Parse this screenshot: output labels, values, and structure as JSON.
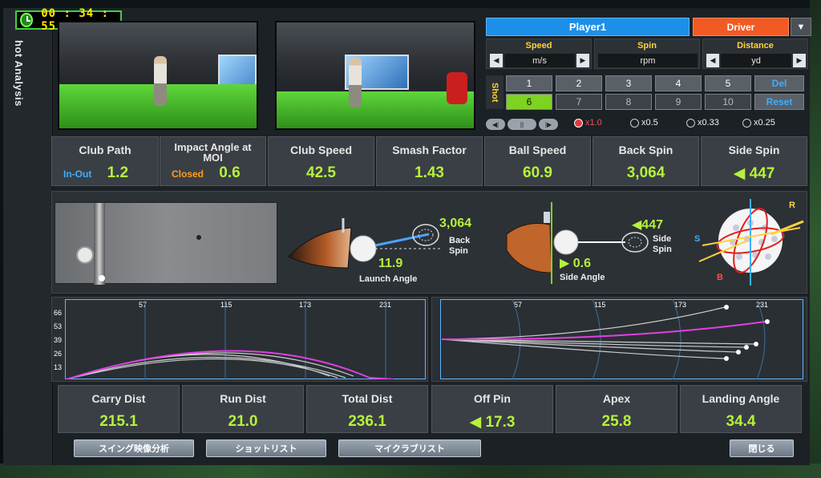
{
  "app": {
    "side_title": "hot Analysis"
  },
  "timer": {
    "value": "00 : 34 : 55"
  },
  "player": {
    "name": "Player1",
    "club": "Driver"
  },
  "units": {
    "speed": {
      "label": "Speed",
      "value": "m/s"
    },
    "spin": {
      "label": "Spin",
      "value": "rpm"
    },
    "distance": {
      "label": "Distance",
      "value": "yd"
    }
  },
  "shots": {
    "label": "Shot",
    "row1": [
      "1",
      "2",
      "3",
      "4",
      "5"
    ],
    "row2": [
      "6",
      "7",
      "8",
      "9",
      "10"
    ],
    "del": "Del",
    "reset": "Reset"
  },
  "playback": {
    "speeds": [
      "x1.0",
      "x0.5",
      "x0.33",
      "x0.25"
    ]
  },
  "stats_top": [
    {
      "label": "Club Path",
      "sub": "In-Out",
      "value": "1.2"
    },
    {
      "label": "Impact Angle at MOI",
      "sub": "Closed",
      "value": "0.6"
    },
    {
      "label": "Club Speed",
      "value": "42.5"
    },
    {
      "label": "Smash Factor",
      "value": "1.43"
    },
    {
      "label": "Ball Speed",
      "value": "60.9"
    },
    {
      "label": "Back Spin",
      "value": "3,064"
    },
    {
      "label": "Side Spin",
      "value": "◀ 447"
    }
  ],
  "impact": {
    "back_spin_value": "3,064",
    "back_spin_label": "Back Spin",
    "launch_angle_value": "11.9",
    "launch_angle_label": "Launch Angle",
    "side_spin_value": "◀447",
    "side_spin_label": "Side Spin",
    "side_angle_value": "▶ 0.6",
    "side_angle_label": "Side Angle",
    "axis_r": "R",
    "axis_s": "S",
    "axis_b": "B"
  },
  "side_chart": {
    "y_ticks": [
      "66",
      "53",
      "39",
      "26",
      "13"
    ],
    "x_ticks": [
      "57",
      "115",
      "173",
      "231"
    ]
  },
  "top_chart": {
    "x_ticks": [
      "57",
      "115",
      "173",
      "231"
    ]
  },
  "stats_bottom": [
    {
      "label": "Carry Dist",
      "value": "215.1"
    },
    {
      "label": "Run Dist",
      "value": "21.0"
    },
    {
      "label": "Total Dist",
      "value": "236.1"
    },
    {
      "label": "Off Pin",
      "value": "◀ 17.3"
    },
    {
      "label": "Apex",
      "value": "25.8"
    },
    {
      "label": "Landing Angle",
      "value": "34.4"
    }
  ],
  "buttons": {
    "swing_video": "スイング映像分析",
    "shot_list": "ショットリスト",
    "my_club_list": "マイクラブリスト",
    "close": "閉じる"
  }
}
